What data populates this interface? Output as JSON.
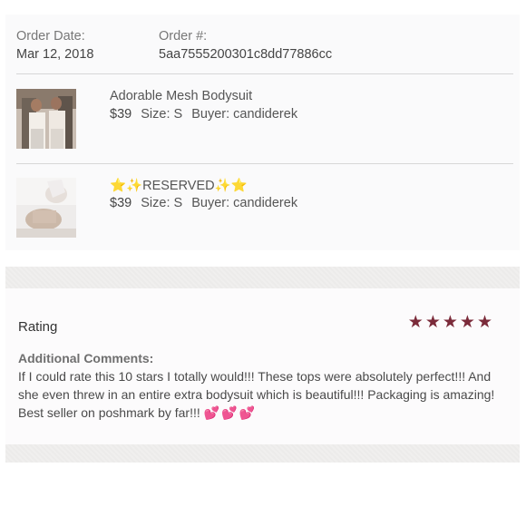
{
  "order": {
    "date_label": "Order Date:",
    "date_value": "Mar 12, 2018",
    "number_label": "Order #:",
    "number_value": "5aa7555200301c8dd77886cc"
  },
  "items": [
    {
      "title": "Adorable Mesh Bodysuit",
      "price": "$39",
      "size": "Size: S",
      "buyer": "Buyer: candiderek"
    },
    {
      "title_prefix": "⭐️✨",
      "title": "RESERVED",
      "title_suffix": "✨⭐️",
      "price": "$39",
      "size": "Size: S",
      "buyer": "Buyer: candiderek"
    }
  ],
  "review": {
    "rating_label": "Rating",
    "stars": 5,
    "comments_heading": "Additional Comments:",
    "comments_text": "If I could rate this 10 stars I totally would!!! These tops were absolutely perfect!!! And she even threw in an entire extra bodysuit which is beautiful!!! Packaging is amazing! Best seller on poshmark by far!!!",
    "comments_emoji": "💕💕💕"
  },
  "colors": {
    "star": "#7b2b3a",
    "divider": "#d7d7d7"
  }
}
